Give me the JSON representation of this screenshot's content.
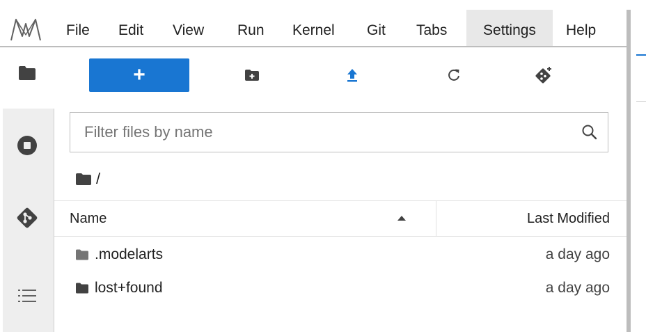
{
  "menu": {
    "items": [
      {
        "label": "File"
      },
      {
        "label": "Edit"
      },
      {
        "label": "View"
      },
      {
        "label": "Run"
      },
      {
        "label": "Kernel"
      },
      {
        "label": "Git"
      },
      {
        "label": "Tabs"
      },
      {
        "label": "Settings"
      },
      {
        "label": "Help"
      }
    ],
    "active": "Settings"
  },
  "sidebar": {
    "icons": [
      "folder-icon",
      "stop-circle-icon",
      "git-icon",
      "list-icon"
    ]
  },
  "toolbar": {
    "new_label": "+",
    "icons": [
      "new-folder-icon",
      "upload-icon",
      "refresh-icon",
      "git-clone-icon"
    ]
  },
  "filter": {
    "placeholder": "Filter files by name",
    "value": ""
  },
  "breadcrumb": {
    "path": "/"
  },
  "file_list": {
    "columns": {
      "name": "Name",
      "modified": "Last Modified"
    },
    "sort_direction": "ascending",
    "rows": [
      {
        "name": ".modelarts",
        "modified": "a day ago",
        "icon": "folder-icon"
      },
      {
        "name": "lost+found",
        "modified": "a day ago",
        "icon": "folder-icon"
      }
    ]
  },
  "colors": {
    "accent": "#1976d2",
    "icon": "#424242",
    "rail": "#eeeeee"
  }
}
